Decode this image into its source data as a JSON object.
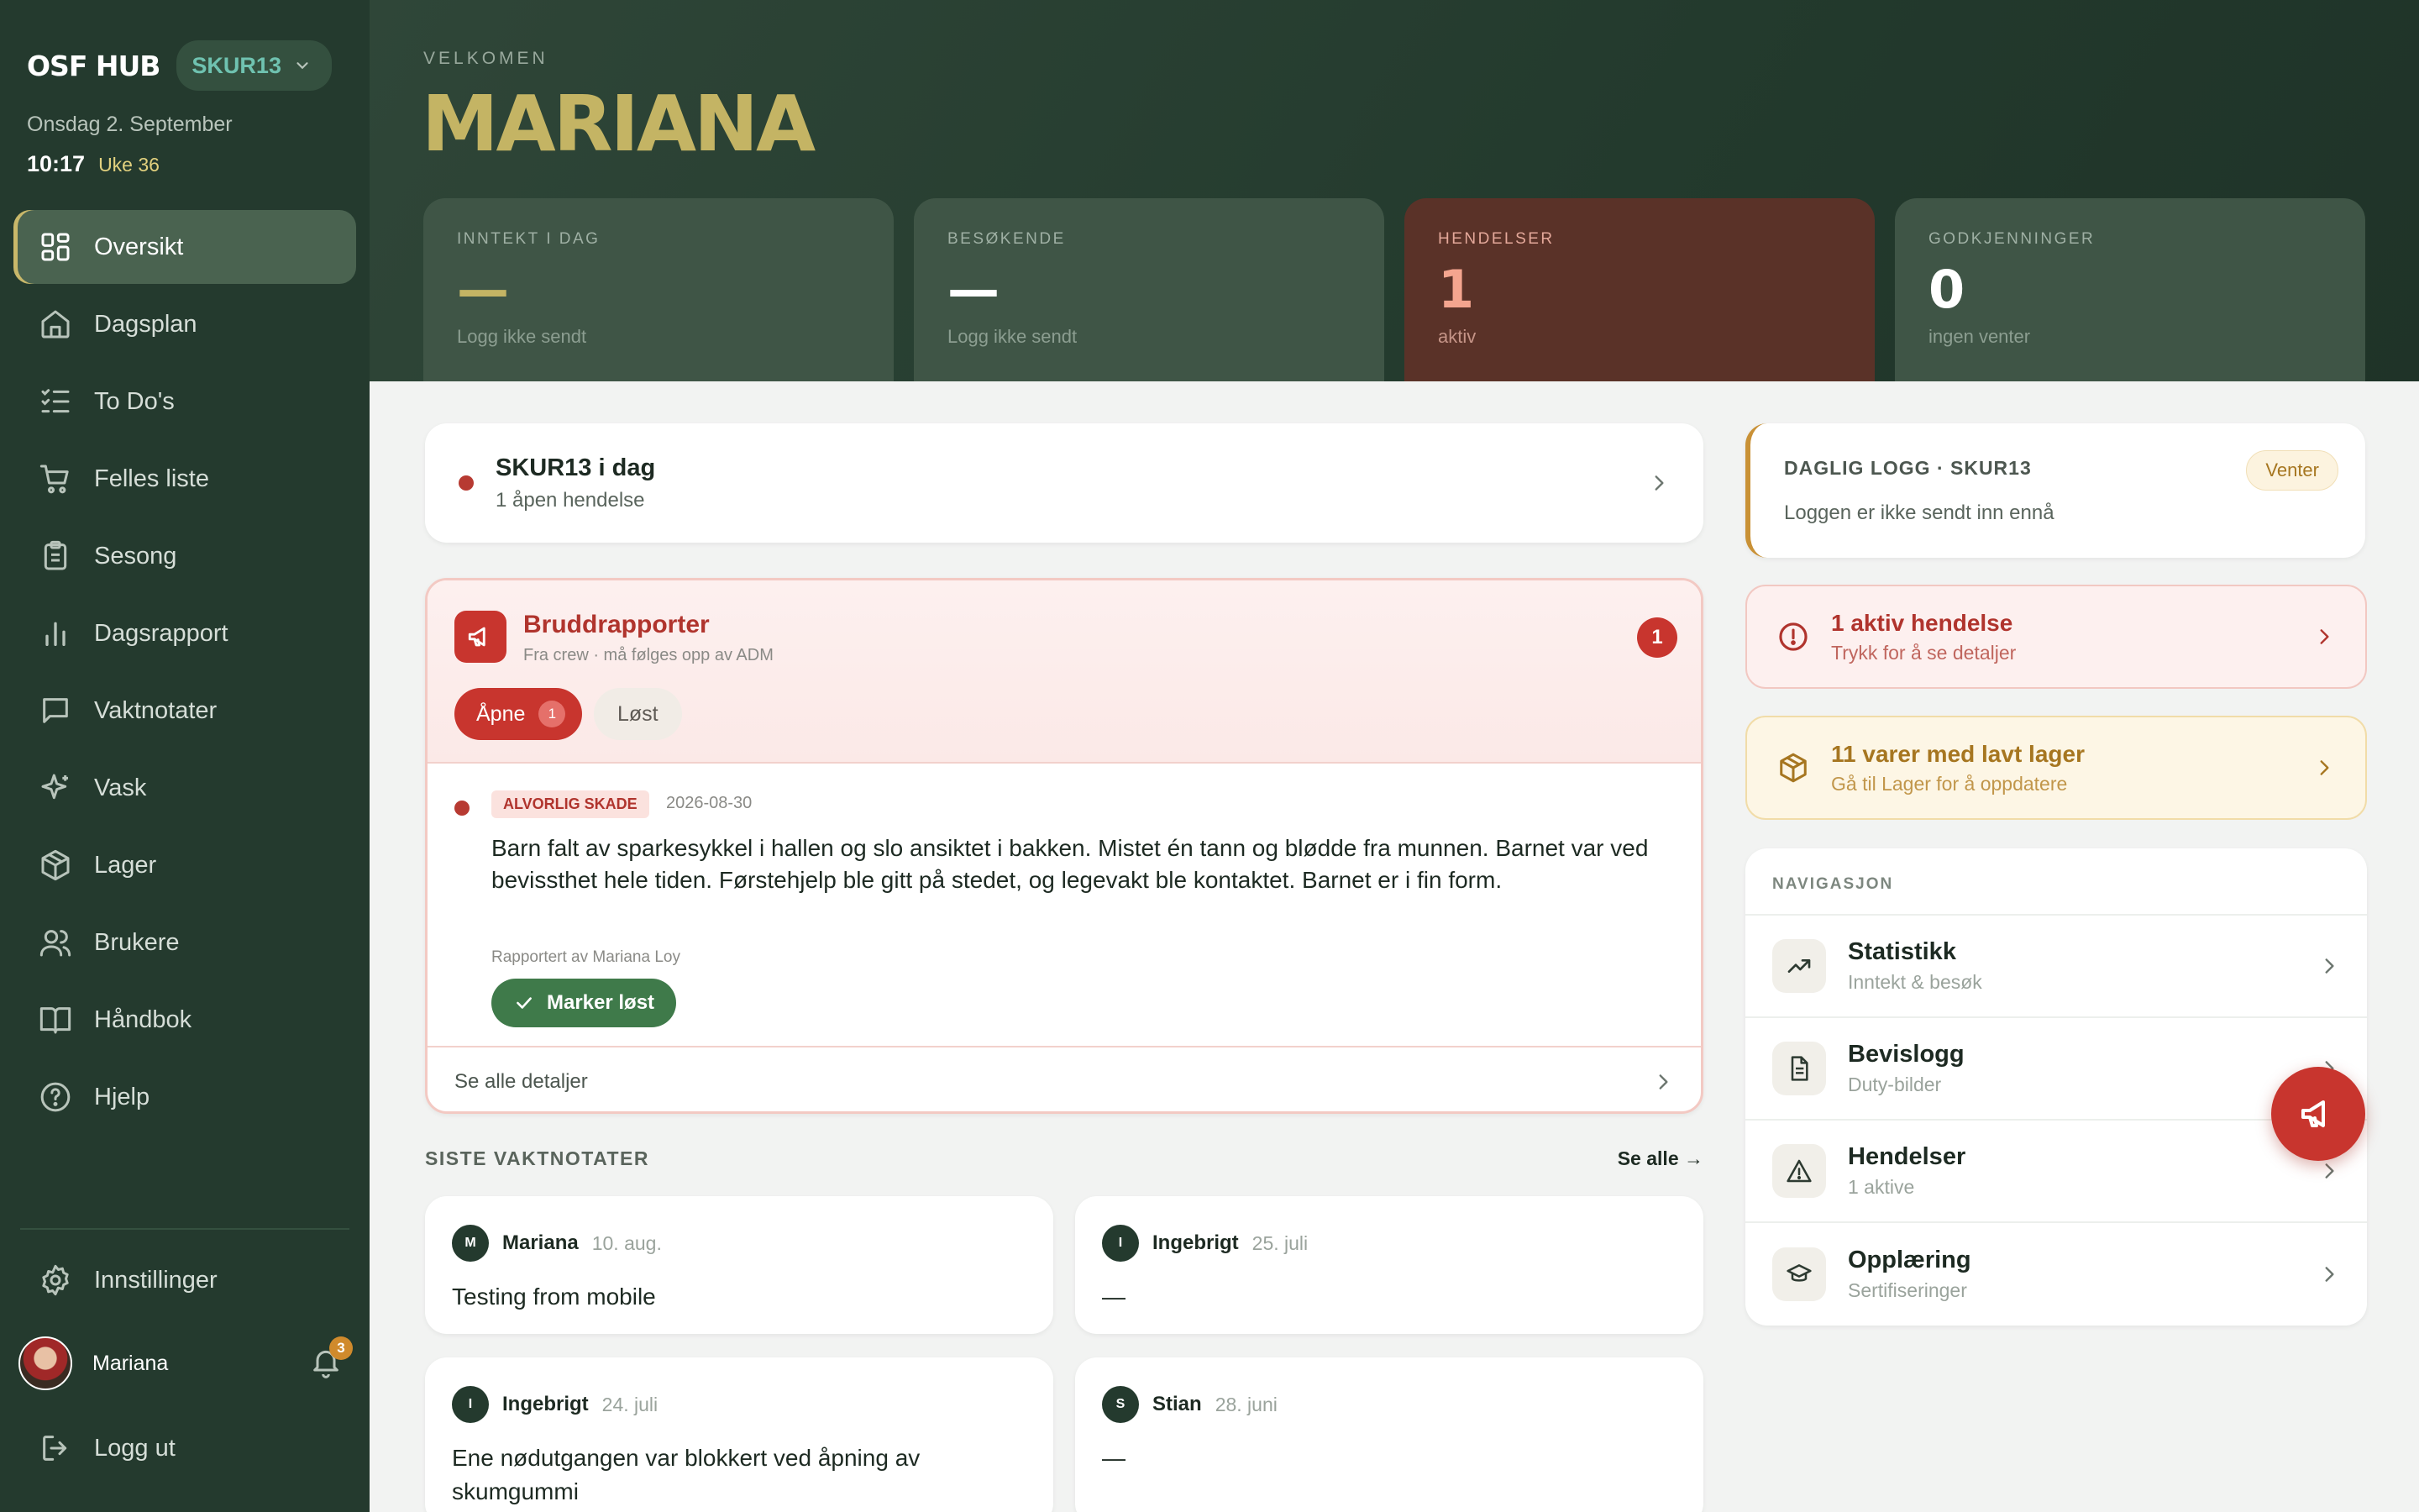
{
  "sidebar": {
    "brand": "OSF HUB",
    "store": "SKUR13",
    "date": "Onsdag 2. September",
    "time": "10:17",
    "week": "Uke 36",
    "items": [
      {
        "label": "Oversikt",
        "icon": "grid-icon"
      },
      {
        "label": "Dagsplan",
        "icon": "home-icon"
      },
      {
        "label": "To Do's",
        "icon": "checklist-icon"
      },
      {
        "label": "Felles liste",
        "icon": "cart-icon"
      },
      {
        "label": "Sesong",
        "icon": "clipboard-icon"
      },
      {
        "label": "Dagsrapport",
        "icon": "bar-chart-icon"
      },
      {
        "label": "Vaktnotater",
        "icon": "message-icon"
      },
      {
        "label": "Vask",
        "icon": "sparkle-icon"
      },
      {
        "label": "Lager",
        "icon": "box-icon"
      },
      {
        "label": "Brukere",
        "icon": "users-icon"
      },
      {
        "label": "Håndbok",
        "icon": "book-icon"
      },
      {
        "label": "Hjelp",
        "icon": "help-icon"
      }
    ],
    "settings": "Innstillinger",
    "user": "Mariana",
    "notifications": "3",
    "logout": "Logg ut"
  },
  "header": {
    "welcome": "VELKOMEN",
    "name": "MARIANA",
    "stats": [
      {
        "label": "INNTEKT I DAG",
        "value": "—",
        "sub": "Logg ikke sendt"
      },
      {
        "label": "BESØKENDE",
        "value": "—",
        "sub": "Logg ikke sendt"
      },
      {
        "label": "HENDELSER",
        "value": "1",
        "sub": "aktiv"
      },
      {
        "label": "GODKJENNINGER",
        "value": "0",
        "sub": "ingen venter"
      }
    ]
  },
  "today": {
    "title": "SKUR13 i dag",
    "sub": "1 åpen hendelse"
  },
  "brudd": {
    "title": "Bruddrapporter",
    "sub": "Fra crew · må følges opp av ADM",
    "count": "1",
    "tab_open": "Åpne",
    "tab_open_count": "1",
    "tab_solved": "Løst",
    "incident": {
      "severity": "ALVORLIG SKADE",
      "date": "2026-08-30",
      "text": "Barn falt av sparkesykkel i hallen og slo ansiktet i bakken. Mistet én tann og blødde fra munnen. Barnet var ved bevissthet hele tiden. Førstehjelp ble gitt på stedet, og legevakt ble kontaktet. Barnet er i fin form.",
      "reported_by": "Rapportert av Mariana Loy",
      "mark_label": "Marker løst"
    },
    "see_all": "Se alle detaljer"
  },
  "notes": {
    "title": "SISTE VAKTNOTATER",
    "see_all": "Se alle →",
    "items": [
      {
        "initial": "M",
        "name": "Mariana",
        "date": "10. aug.",
        "text": "Testing from mobile"
      },
      {
        "initial": "I",
        "name": "Ingebrigt",
        "date": "25. juli",
        "text": "—"
      },
      {
        "initial": "I",
        "name": "Ingebrigt",
        "date": "24. juli",
        "text": "Ene nødutgangen var blokkert ved åpning av skumgummi"
      },
      {
        "initial": "S",
        "name": "Stian",
        "date": "28. juni",
        "text": "—"
      }
    ]
  },
  "log": {
    "title": "DAGLIG LOGG · SKUR13",
    "badge": "Venter",
    "sub": "Loggen er ikke sendt inn ennå"
  },
  "alerts": {
    "incident": {
      "title": "1 aktiv hendelse",
      "sub": "Trykk for å se detaljer"
    },
    "stock": {
      "title": "11 varer med lavt lager",
      "sub": "Gå til Lager for å oppdatere"
    }
  },
  "navigation": {
    "title": "NAVIGASJON",
    "items": [
      {
        "title": "Statistikk",
        "sub": "Inntekt & besøk",
        "icon": "trend-icon"
      },
      {
        "title": "Bevislogg",
        "sub": "Duty-bilder",
        "icon": "document-icon"
      },
      {
        "title": "Hendelser",
        "sub": "1 aktive",
        "icon": "warning-icon"
      },
      {
        "title": "Opplæring",
        "sub": "Sertifiseringer",
        "icon": "graduation-cap-icon"
      }
    ]
  },
  "colors": {
    "sidebar": "#243a2e",
    "accent_gold": "#c4b464",
    "danger": "#c8352e",
    "success": "#3f7a4a",
    "warning": "#a67620"
  }
}
